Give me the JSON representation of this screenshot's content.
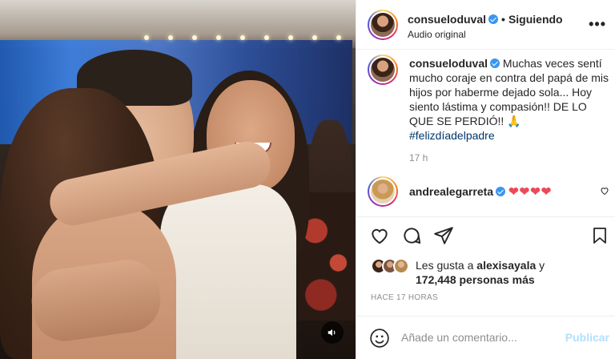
{
  "post": {
    "username": "consueloduval",
    "follow_status": "Siguiendo",
    "separator": "•",
    "audio": "Audio original",
    "more": "•••",
    "caption_username": "consueloduval",
    "caption": "Muchas veces sentí mucho coraje en contra del papá de mis hijos por haberme dejado sola... Hoy siento lástima y compasión!! DE LO QUE SE PERDIÓ!! 🙏",
    "hashtag": "#felizdíadelpadre",
    "caption_time": "17 h"
  },
  "comment": {
    "username": "andrealegarreta",
    "text": "❤❤❤❤"
  },
  "likes": {
    "prefix": "Les gusta a ",
    "first_liker": "alexisayala",
    "connector": " y",
    "count": "172,448 personas más"
  },
  "post_date": "HACE 17 HORAS",
  "composer": {
    "placeholder": "Añade un comentario...",
    "publish": "Publicar"
  },
  "icons": [
    "heart-icon",
    "comment-icon",
    "share-icon",
    "bookmark-icon",
    "emoji-icon",
    "volume-icon",
    "verified-icon",
    "more-icon"
  ]
}
